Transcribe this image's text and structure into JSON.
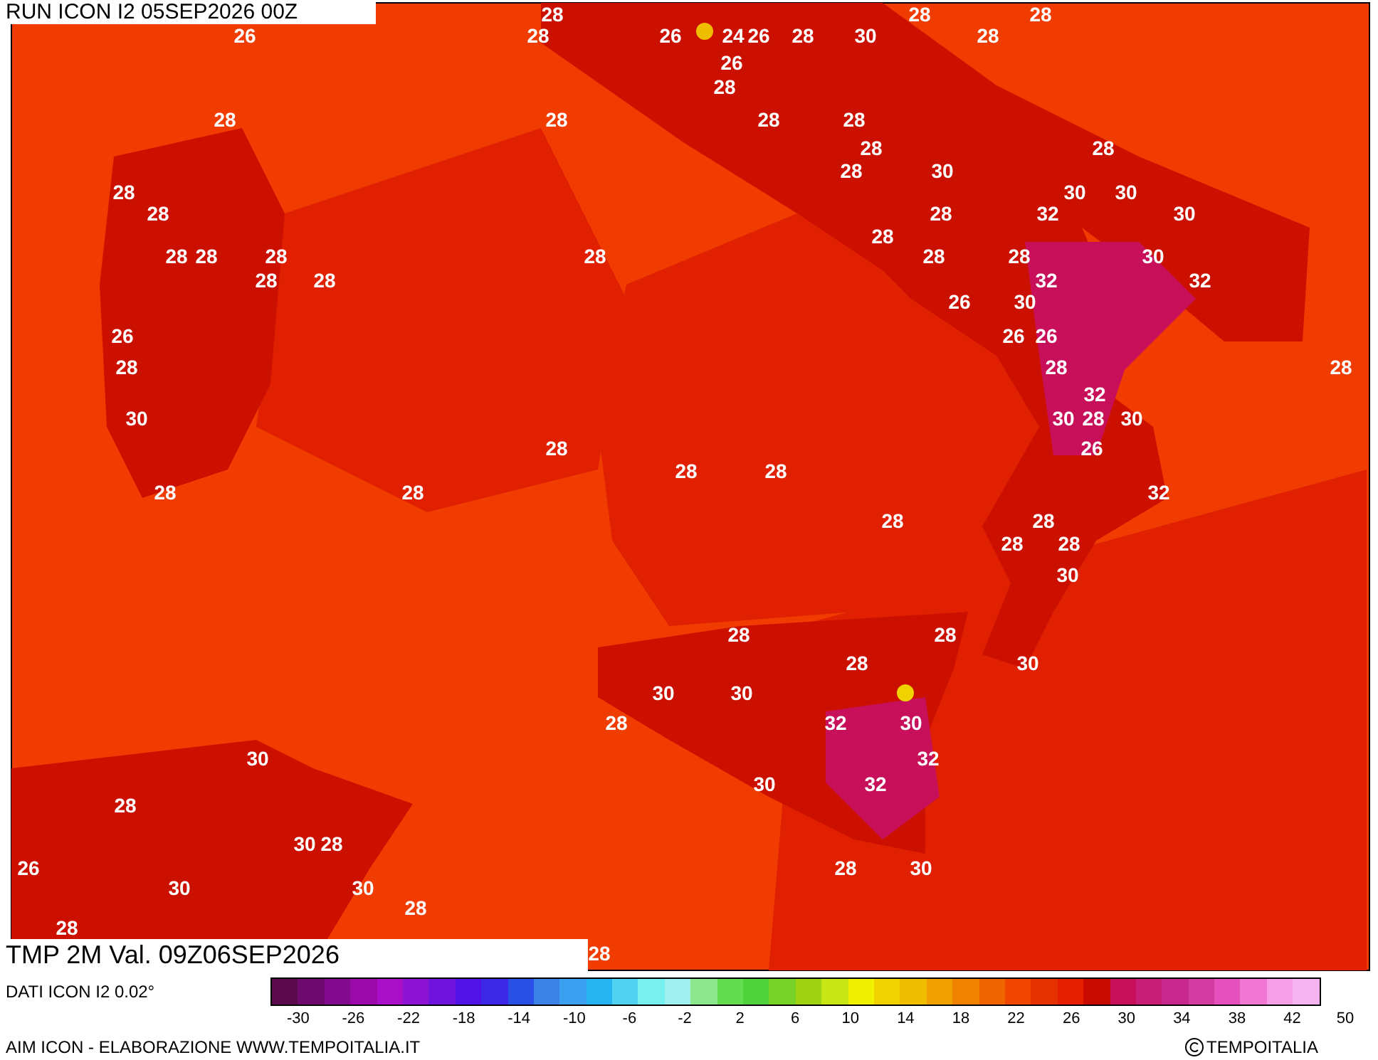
{
  "header": {
    "run": "RUN ICON I2 05SEP2026 00Z"
  },
  "map": {
    "contour_labels": [
      "28",
      "28",
      "28",
      "26",
      "28",
      "26",
      "24",
      "26",
      "28",
      "30",
      "28",
      "26",
      "28",
      "28",
      "28",
      "28",
      "28",
      "28",
      "28",
      "28",
      "30",
      "28",
      "30",
      "30",
      "28",
      "28",
      "32",
      "30",
      "28",
      "28",
      "28",
      "28",
      "28",
      "28",
      "28",
      "30",
      "28",
      "28",
      "32",
      "32",
      "26",
      "30",
      "26",
      "26",
      "26",
      "28",
      "28",
      "28",
      "32",
      "30",
      "30",
      "28",
      "30",
      "28",
      "26",
      "28",
      "28",
      "28",
      "28",
      "32",
      "28",
      "28",
      "28",
      "28",
      "30",
      "28",
      "28",
      "28",
      "30",
      "30",
      "30",
      "28",
      "32",
      "30",
      "30",
      "32",
      "30",
      "32",
      "28",
      "30",
      "28",
      "26",
      "28",
      "30",
      "30",
      "30",
      "28",
      "28",
      "28"
    ]
  },
  "validity": "TMP 2M Val. 09Z06SEP2026",
  "source_note": "DATI ICON I2 0.02°",
  "legend": {
    "bins": [
      {
        "color": "#5a0a4a"
      },
      {
        "color": "#6e0a6e"
      },
      {
        "color": "#820a8c"
      },
      {
        "color": "#9a0aaa"
      },
      {
        "color": "#aa10c8"
      },
      {
        "color": "#8c14d2"
      },
      {
        "color": "#6e14dc"
      },
      {
        "color": "#5014e6"
      },
      {
        "color": "#3c28e6"
      },
      {
        "color": "#2850e6"
      },
      {
        "color": "#3c82e6"
      },
      {
        "color": "#3ca0f0"
      },
      {
        "color": "#28b4f0"
      },
      {
        "color": "#50d2f0"
      },
      {
        "color": "#78f0f0"
      },
      {
        "color": "#a0f0f0"
      },
      {
        "color": "#8ce68c"
      },
      {
        "color": "#64dc50"
      },
      {
        "color": "#50d23c"
      },
      {
        "color": "#78d228"
      },
      {
        "color": "#a0d214"
      },
      {
        "color": "#c8e614"
      },
      {
        "color": "#f0f000"
      },
      {
        "color": "#f0d200"
      },
      {
        "color": "#f0be00"
      },
      {
        "color": "#f0a000"
      },
      {
        "color": "#f08200"
      },
      {
        "color": "#f06400"
      },
      {
        "color": "#f04600"
      },
      {
        "color": "#e63200"
      },
      {
        "color": "#e61e00"
      },
      {
        "color": "#c80a00"
      },
      {
        "color": "#c8105a"
      },
      {
        "color": "#c81e78"
      },
      {
        "color": "#c8288c"
      },
      {
        "color": "#d23ca0"
      },
      {
        "color": "#e650be"
      },
      {
        "color": "#f078d2"
      },
      {
        "color": "#f5a0e6"
      },
      {
        "color": "#f5b4f0"
      }
    ],
    "labels": [
      "-30",
      "-26",
      "-22",
      "-18",
      "-14",
      "-10",
      "-6",
      "-2",
      "2",
      "6",
      "10",
      "14",
      "18",
      "22",
      "26",
      "30",
      "34",
      "38",
      "42",
      "50"
    ]
  },
  "credit": "AIM ICON - ELABORAZIONE WWW.TEMPOITALIA.IT",
  "copyright": "TEMPOITALIA"
}
